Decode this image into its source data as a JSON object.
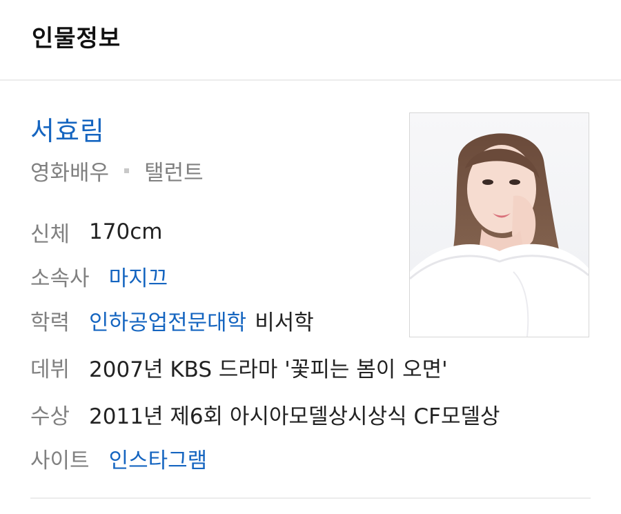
{
  "header": {
    "title": "인물정보"
  },
  "profile": {
    "name": "서효림",
    "roles": [
      "영화배우",
      "탤런트"
    ],
    "rows": {
      "body": {
        "label": "신체",
        "value": "170cm"
      },
      "agency": {
        "label": "소속사",
        "link": "마지끄"
      },
      "education": {
        "label": "학력",
        "link": "인하공업전문대학",
        "suffix": "비서학"
      },
      "debut": {
        "label": "데뷔",
        "value": "2007년 KBS 드라마 '꽃피는 봄이 오면'"
      },
      "award": {
        "label": "수상",
        "value": "2011년 제6회 아시아모델상시상식 CF모델상"
      },
      "site": {
        "label": "사이트",
        "link": "인스타그램"
      }
    },
    "photo_alt": "서효림"
  },
  "colors": {
    "link": "#1565c0",
    "label": "#808080",
    "text": "#222222",
    "divider": "#ececec"
  }
}
